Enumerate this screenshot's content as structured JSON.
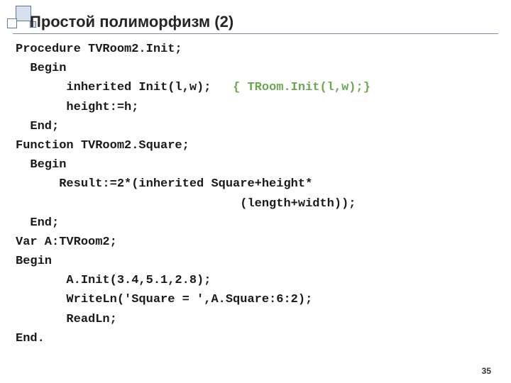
{
  "title": "Простой полиморфизм (2)",
  "page_number": "35",
  "code": {
    "l1": "Procedure TVRoom2.Init;",
    "l2": "  Begin",
    "l3a": "       inherited Init(l,w);   ",
    "l3b": "{ TRoom.Init(l,w);}",
    "l4": "       height:=h;",
    "l5": "  End;",
    "l6": "Function TVRoom2.Square;",
    "l7": "  Begin",
    "l8": "      Result:=2*(inherited Square+height*",
    "l9": "                               (length+width));",
    "l10": "  End;",
    "l11": "Var A:TVRoom2;",
    "l12": "Begin",
    "l13": "       A.Init(3.4,5.1,2.8);",
    "l14": "       WriteLn('Square = ',A.Square:6:2);",
    "l15": "       ReadLn;",
    "l16": "End."
  }
}
